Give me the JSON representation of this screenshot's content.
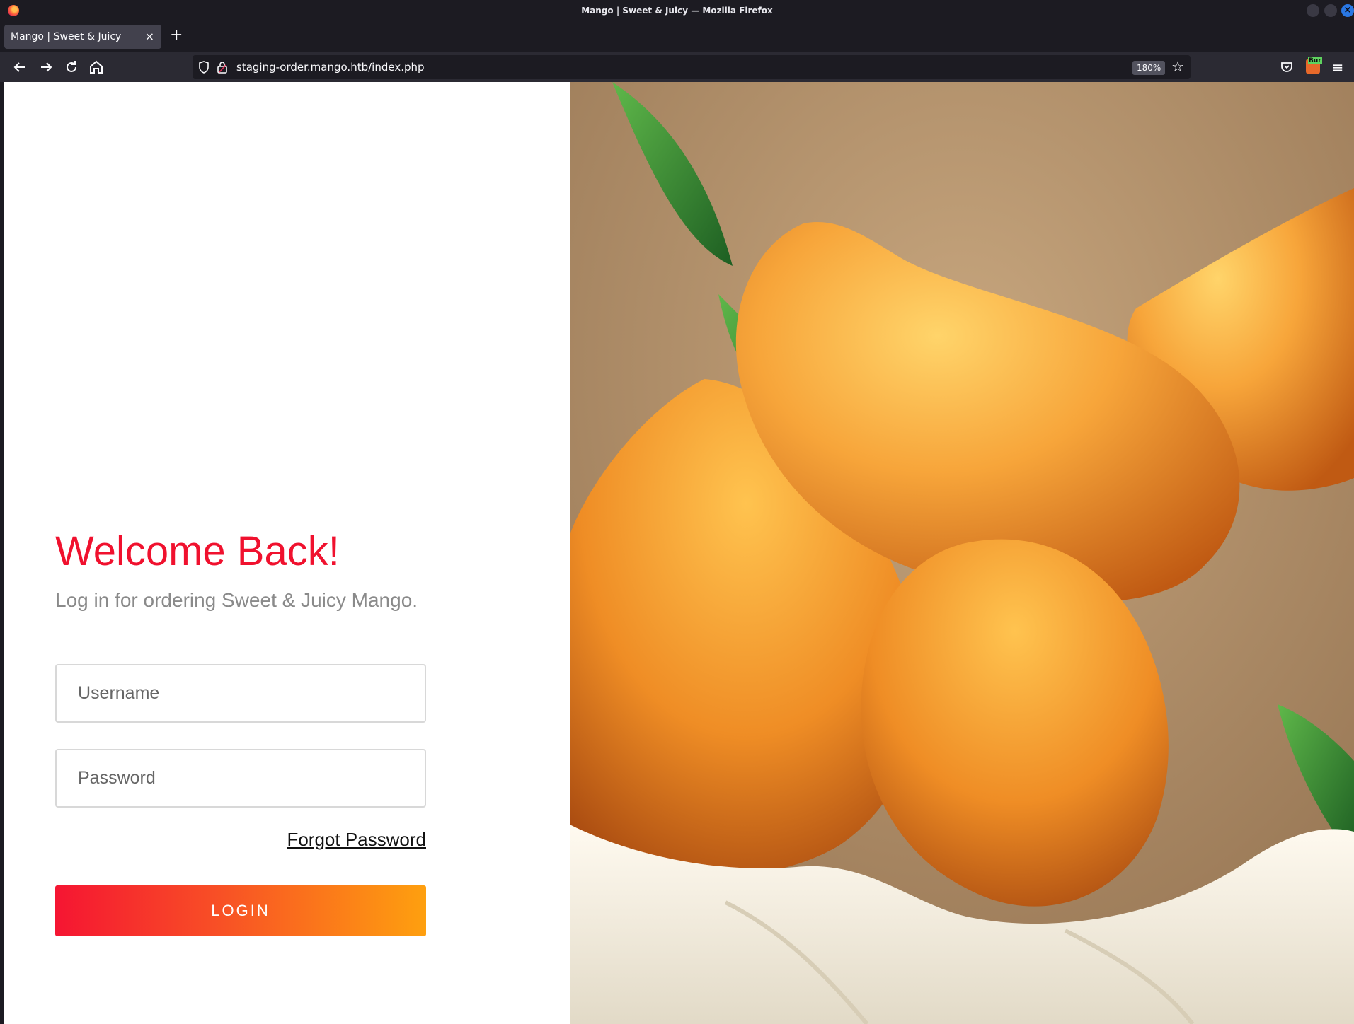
{
  "window": {
    "title": "Mango | Sweet & Juicy — Mozilla Firefox"
  },
  "tab": {
    "title": "Mango | Sweet & Juicy",
    "close": "×",
    "new_tab": "+"
  },
  "nav": {
    "url": "staging-order.mango.htb/index.php",
    "zoom": "180%",
    "burp_label": "Bur"
  },
  "page": {
    "heading": "Welcome Back!",
    "subtitle": "Log in for ordering Sweet & Juicy Mango.",
    "username_placeholder": "Username",
    "password_placeholder": "Password",
    "forgot_password": "Forgot Password",
    "login_label": "LOGIN"
  },
  "colors": {
    "heading": "#f0112e",
    "button_gradient_start": "#f51532",
    "button_gradient_end": "#fea00f",
    "browser_chrome": "#1c1b22"
  },
  "icons": [
    "firefox-logo-icon",
    "back-arrow-icon",
    "forward-arrow-icon",
    "reload-icon",
    "home-icon",
    "shield-icon",
    "lock-icon",
    "star-icon",
    "pocket-icon",
    "burp-extension-icon",
    "hamburger-menu-icon"
  ]
}
